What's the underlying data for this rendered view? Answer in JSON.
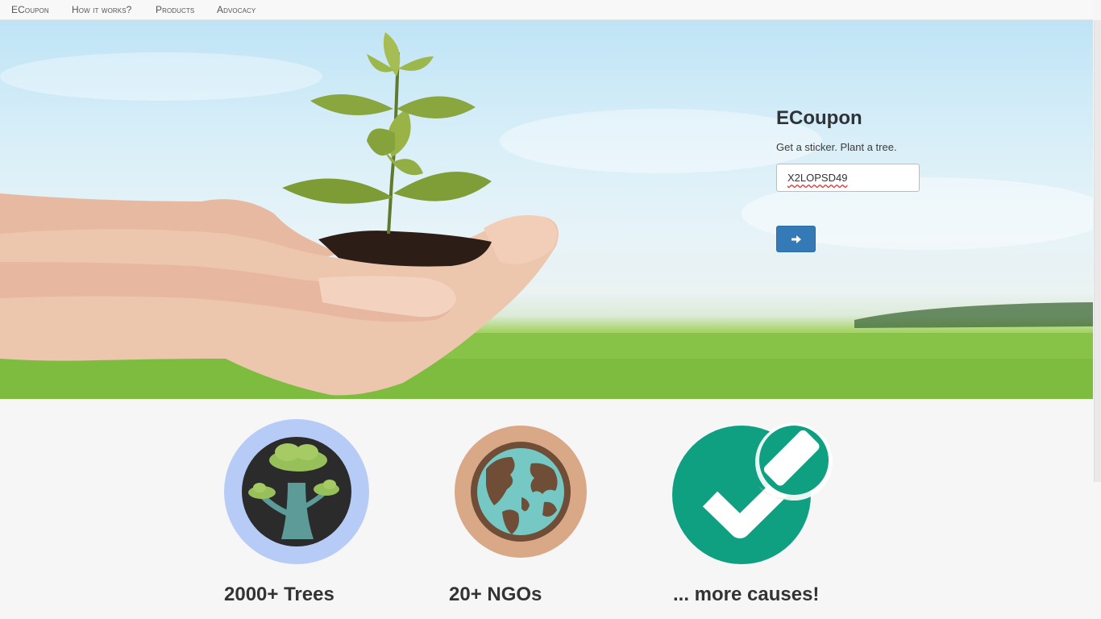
{
  "navbar": {
    "brand": "ECoupon",
    "items": [
      {
        "label": "How it works?"
      },
      {
        "label": "Products"
      },
      {
        "label": "Advocacy"
      }
    ]
  },
  "hero": {
    "title": "ECoupon",
    "tagline": "Get a sticker. Plant a tree.",
    "coupon_value": "X2LOPSD49",
    "submit_icon": "arrow-right-icon"
  },
  "features": [
    {
      "label": "2000+ Trees",
      "icon": "tree-icon",
      "color": "#b6cbf6"
    },
    {
      "label": "20+ NGOs",
      "icon": "globe-icon",
      "color": "#d9a987"
    },
    {
      "label": "... more causes!",
      "icon": "checkmark-icon",
      "color": "#0fa082"
    }
  ],
  "colors": {
    "primary_button": "#337ab7",
    "page_background": "#f6f6f6"
  }
}
